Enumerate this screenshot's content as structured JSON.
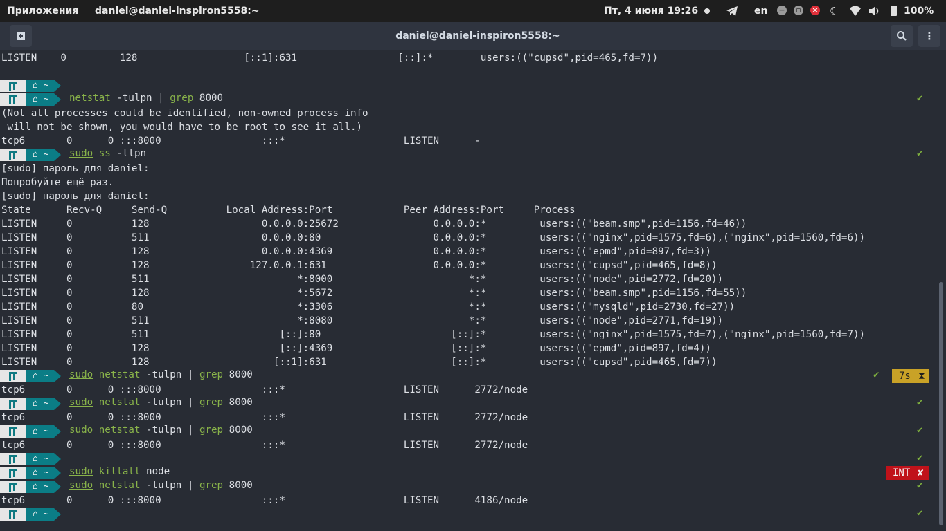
{
  "topbar": {
    "apps": "Приложения",
    "window_title": "daniel@daniel-inspiron5558:~",
    "datetime": "Пт, 4 июня  19:26",
    "lang": "en",
    "battery": "100%"
  },
  "titlebar": {
    "title": "daniel@daniel-inspiron5558:~"
  },
  "prompt_dir": "~",
  "lines": {
    "l0": "LISTEN    0         128                  [::1]:631                 [::]:*        users:((\"cupsd\",pid=465,fd=7))",
    "l3": "(Not all processes could be identified, non-owned process info",
    "l4": " will not be shown, you would have to be root to see it all.)",
    "l5": "tcp6       0      0 :::8000                 :::*                    LISTEN      -",
    "l7": "[sudo] пароль для daniel:",
    "l8": "Попробуйте ещё раз.",
    "l9": "[sudo] пароль для daniel:",
    "l10": "State      Recv-Q     Send-Q          Local Address:Port            Peer Address:Port     Process",
    "l11": "LISTEN     0          128                   0.0.0.0:25672                0.0.0.0:*         users:((\"beam.smp\",pid=1156,fd=46))",
    "l12": "LISTEN     0          511                   0.0.0.0:80                   0.0.0.0:*         users:((\"nginx\",pid=1575,fd=6),(\"nginx\",pid=1560,fd=6))",
    "l13": "LISTEN     0          128                   0.0.0.0:4369                 0.0.0.0:*         users:((\"epmd\",pid=897,fd=3))",
    "l14": "LISTEN     0          128                 127.0.0.1:631                  0.0.0.0:*         users:((\"cupsd\",pid=465,fd=8))",
    "l15": "LISTEN     0          511                         *:8000                       *:*         users:((\"node\",pid=2772,fd=20))",
    "l16": "LISTEN     0          128                         *:5672                       *:*         users:((\"beam.smp\",pid=1156,fd=55))",
    "l17": "LISTEN     0          80                          *:3306                       *:*         users:((\"mysqld\",pid=2730,fd=27))",
    "l18": "LISTEN     0          511                         *:8080                       *:*         users:((\"node\",pid=2771,fd=19))",
    "l19": "LISTEN     0          511                      [::]:80                      [::]:*         users:((\"nginx\",pid=1575,fd=7),(\"nginx\",pid=1560,fd=7))",
    "l20": "LISTEN     0          128                      [::]:4369                    [::]:*         users:((\"epmd\",pid=897,fd=4))",
    "l21": "LISTEN     0          128                     [::1]:631                     [::]:*         users:((\"cupsd\",pid=465,fd=7))",
    "l23": "tcp6       0      0 :::8000                 :::*                    LISTEN      2772/node",
    "l25": "tcp6       0      0 :::8000                 :::*                    LISTEN      2772/node",
    "l27": "tcp6       0      0 :::8000                 :::*                    LISTEN      2772/node",
    "l31": "tcp6       0      0 :::8000                 :::*                    LISTEN      4186/node"
  },
  "cmd": {
    "sudo": "sudo",
    "netstat": "netstat",
    "grep": "grep",
    "ss": "ss",
    "killall": "killall",
    "tulpn": " -tulpn | ",
    "port": " 8000",
    "tlpn": " -tlpn",
    "node": " node"
  },
  "status": {
    "check": "✔",
    "time": "7s",
    "int": "INT",
    "int_x": "✘"
  }
}
